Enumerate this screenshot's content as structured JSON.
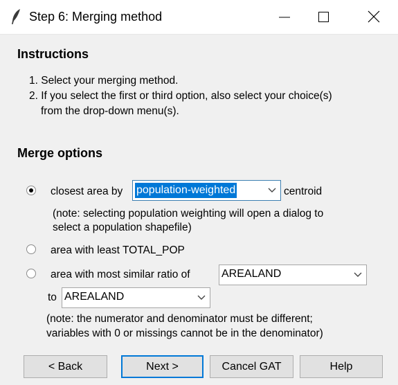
{
  "window": {
    "title": "Step 6: Merging method",
    "minimize_icon": "minimize-icon",
    "maximize_icon": "maximize-icon",
    "close_icon": "close-icon",
    "app_icon": "feather-icon"
  },
  "instructions": {
    "heading": "Instructions",
    "line1": "1. Select your merging method.",
    "line2": "2. If you select the first or third option, also select your choice(s)",
    "line3": "from the drop-down menu(s)."
  },
  "merge": {
    "heading": "Merge options",
    "option1": {
      "label_before": "closest area by",
      "select_value": "population-weighted",
      "label_after": "centroid",
      "note_line1": "(note: selecting population weighting will open a dialog to",
      "note_line2": "select a population shapefile)",
      "selected": true
    },
    "option2": {
      "label": "area with least TOTAL_POP",
      "selected": false
    },
    "option3": {
      "label": "area with most similar ratio of",
      "numerator_value": "AREALAND",
      "to_label": "to",
      "denominator_value": "AREALAND",
      "note_line1": "(note: the numerator and denominator must be different;",
      "note_line2": "variables with 0 or missings cannot be in the denominator)",
      "selected": false
    }
  },
  "buttons": {
    "back": "< Back",
    "next": "Next >",
    "cancel": "Cancel GAT",
    "help": "Help"
  },
  "colors": {
    "accent": "#0078d7",
    "background": "#f0f0f0"
  }
}
